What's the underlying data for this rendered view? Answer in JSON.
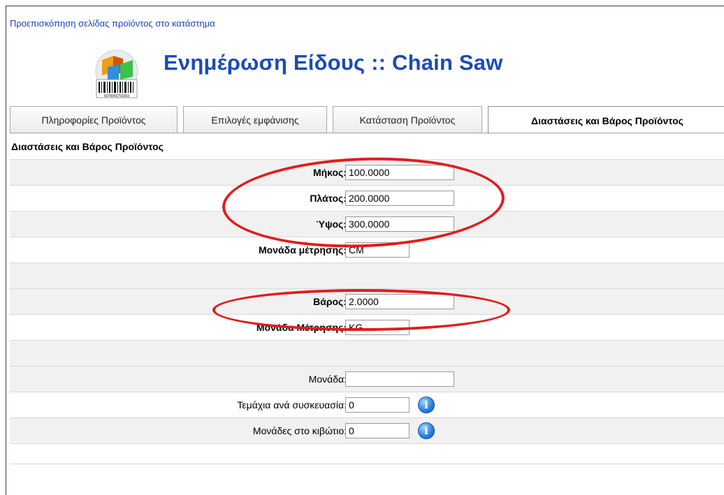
{
  "preview_link": "Προεπισκόπηση σελίδας προϊόντος στο κατάστημα",
  "page_title": "Ενημέρωση Είδους :: Chain Saw",
  "logo": {
    "icon": "product-barcode-logo",
    "barcode_text": "6078943756903"
  },
  "tabs": [
    {
      "label": "Πληροφορίες Προϊόντος",
      "active": false
    },
    {
      "label": "Επιλογές εμφάνισης",
      "active": false
    },
    {
      "label": "Κατάσταση Προϊόντος",
      "active": false
    },
    {
      "label": "Διαστάσεις και Βάρος Προϊόντος",
      "active": true
    }
  ],
  "section_title": "Διαστάσεις και Βάρος Προϊόντος",
  "fields": {
    "length": {
      "label": "Μήκος:",
      "value": "100.0000"
    },
    "width": {
      "label": "Πλάτος:",
      "value": "200.0000"
    },
    "height": {
      "label": "Ύψος:",
      "value": "300.0000"
    },
    "dim_unit": {
      "label": "Μονάδα μέτρησης:",
      "value": "CM"
    },
    "weight": {
      "label": "Βάρος:",
      "value": "2.0000"
    },
    "weight_unit": {
      "label": "Μονάδα Μέτρησης:",
      "value": "KG"
    },
    "unit": {
      "label": "Μονάδα:",
      "value": ""
    },
    "pieces_per_pack": {
      "label": "Τεμάχια ανά συσκευασία:",
      "value": "0"
    },
    "units_per_box": {
      "label": "Μονάδες στο κιβώτιο:",
      "value": "0"
    }
  },
  "colors": {
    "title": "#1c4bb5",
    "link": "#1a44b8",
    "annotation": "#e11d1d",
    "row_shade": "#f1f1f1"
  }
}
